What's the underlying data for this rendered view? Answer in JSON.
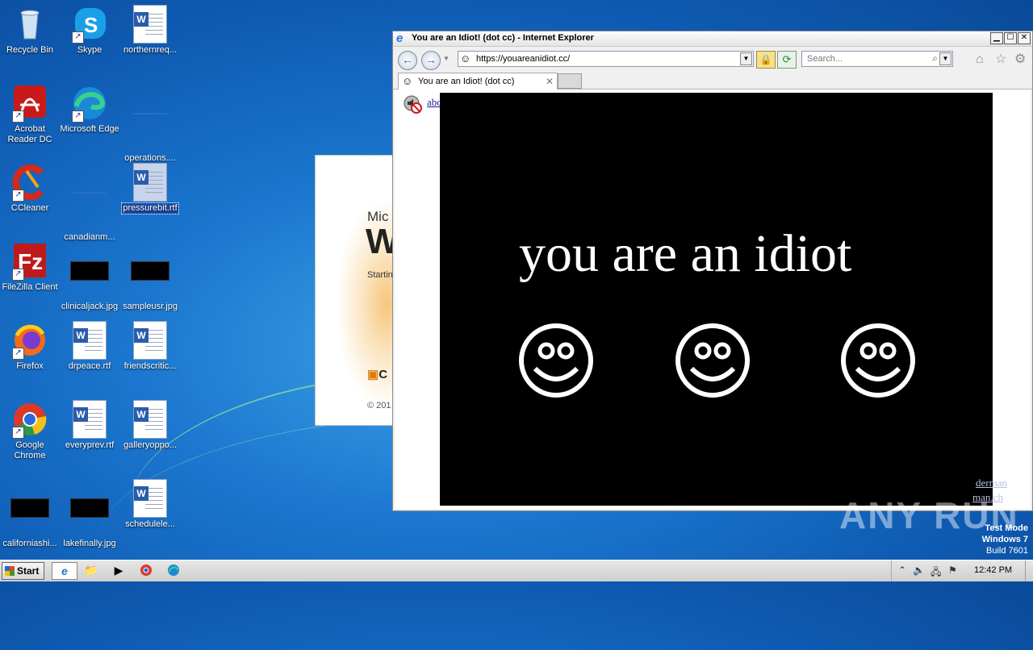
{
  "desktop": {
    "icons": [
      {
        "label": "Recycle Bin",
        "icon": "recycle-bin-icon"
      },
      {
        "label": "Skype",
        "icon": "skype-icon"
      },
      {
        "label": "northernreq...",
        "icon": "word-doc-icon"
      },
      {
        "label": "Acrobat Reader DC",
        "icon": "acrobat-icon"
      },
      {
        "label": "Microsoft Edge",
        "icon": "edge-icon"
      },
      {
        "label": "operations....",
        "icon": "file-icon"
      },
      {
        "label": "CCleaner",
        "icon": "ccleaner-icon"
      },
      {
        "label": "canadianm...",
        "icon": "file-icon"
      },
      {
        "label": "pressurebit.rtf",
        "icon": "word-doc-icon"
      },
      {
        "label": "FileZilla Client",
        "icon": "filezilla-icon"
      },
      {
        "label": "clinicaljack.jpg",
        "icon": "image-icon"
      },
      {
        "label": "sampleusr.jpg",
        "icon": "image-icon"
      },
      {
        "label": "Firefox",
        "icon": "firefox-icon"
      },
      {
        "label": "drpeace.rtf",
        "icon": "word-doc-icon"
      },
      {
        "label": "friendscritic...",
        "icon": "word-doc-icon"
      },
      {
        "label": "Google Chrome",
        "icon": "chrome-icon"
      },
      {
        "label": "everyprev.rtf",
        "icon": "word-doc-icon"
      },
      {
        "label": "galleryoppo...",
        "icon": "word-doc-icon"
      },
      {
        "label": "californiashi...",
        "icon": "image-icon"
      },
      {
        "label": "lakefinally.jpg",
        "icon": "image-icon"
      },
      {
        "label": "schedulele...",
        "icon": "word-doc-icon"
      }
    ]
  },
  "splash": {
    "line1": "Mic",
    "line2": "W",
    "line3": "Startin",
    "brand_mark": "C",
    "copyright": "© 201"
  },
  "ie": {
    "title": "You are an Idiot! (dot cc) - Internet Explorer",
    "address": "https://youareanidiot.cc/",
    "search_placeholder": "Search...",
    "tab_label": "You are an Idiot! (dot cc)",
    "content": {
      "top_link": "about privacy safe",
      "headline": "you are an idiot",
      "faint_link_1": "derman",
      "faint_link_2": "man.ch"
    }
  },
  "watermark": "ANY RUN",
  "system": {
    "test_mode": "Test Mode",
    "os": "Windows 7",
    "build": "Build 7601"
  },
  "taskbar": {
    "start_label": "Start",
    "clock": "12:42 PM"
  }
}
